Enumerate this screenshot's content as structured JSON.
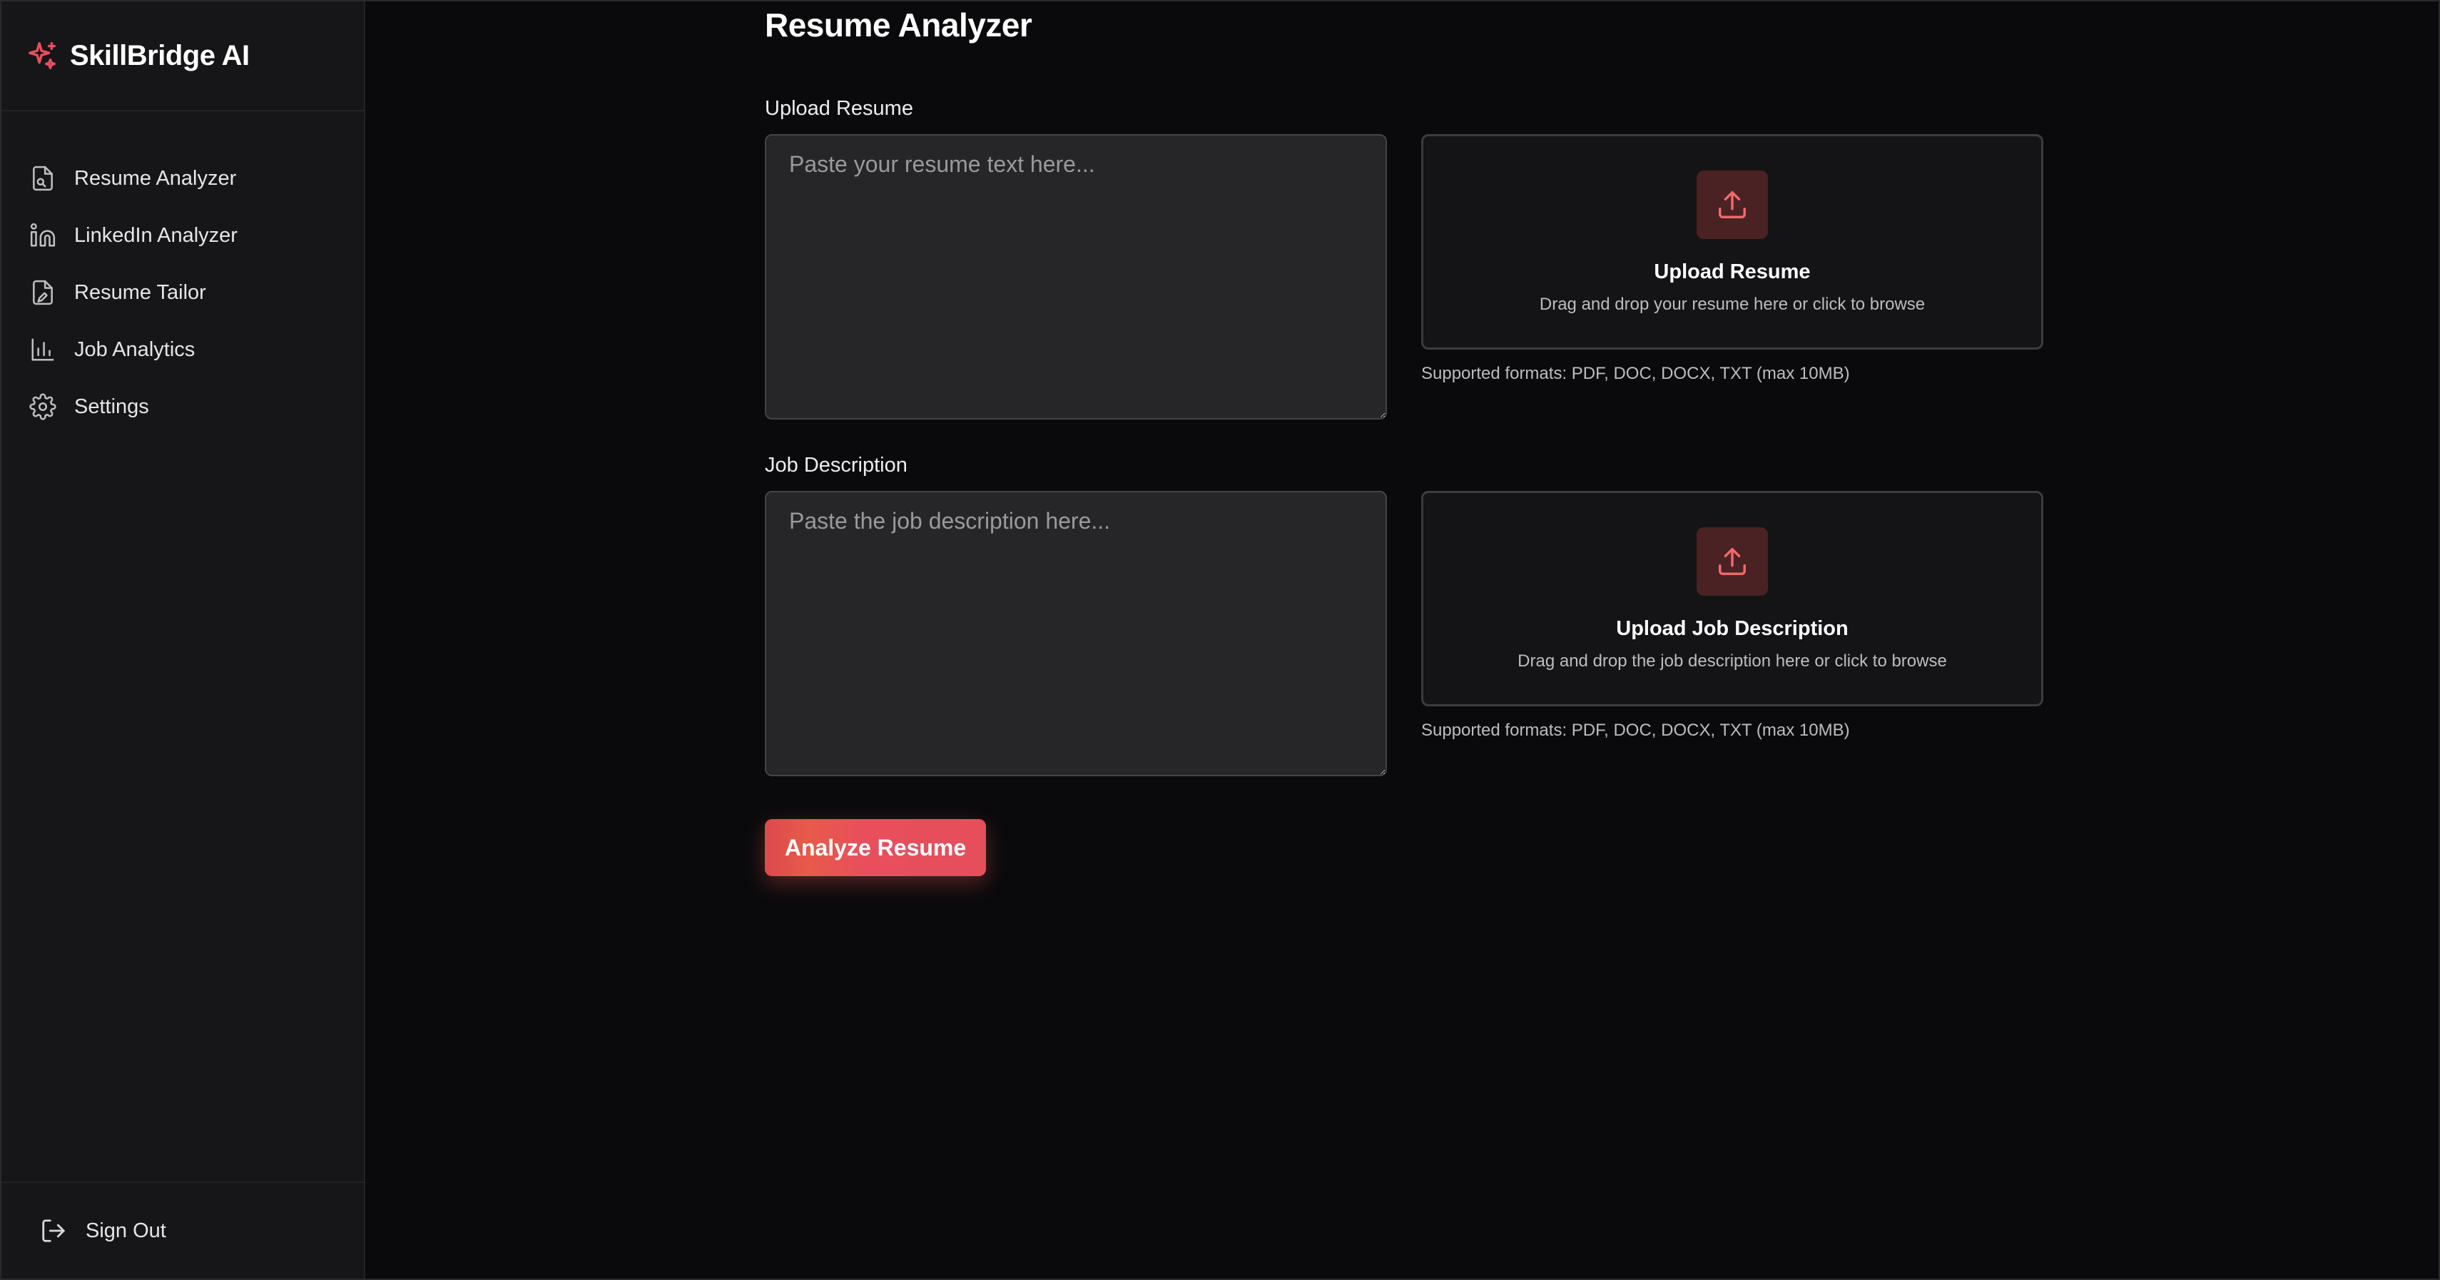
{
  "app": {
    "brand_name": "SkillBridge AI"
  },
  "colors": {
    "accent": "#e84e5c",
    "background": "#0a0a0c",
    "sidebar": "#161618"
  },
  "sidebar": {
    "items": [
      {
        "label": "Resume Analyzer",
        "icon": "file-search-icon"
      },
      {
        "label": "LinkedIn Analyzer",
        "icon": "linkedin-icon"
      },
      {
        "label": "Resume Tailor",
        "icon": "file-edit-icon"
      },
      {
        "label": "Job Analytics",
        "icon": "bar-chart-icon"
      },
      {
        "label": "Settings",
        "icon": "gear-icon"
      }
    ],
    "sign_out_label": "Sign Out"
  },
  "main": {
    "title": "Resume Analyzer",
    "resume": {
      "label": "Upload Resume",
      "placeholder": "Paste your resume text here...",
      "dropzone_title": "Upload Resume",
      "dropzone_subtitle": "Drag and drop your resume here or click to browse",
      "formats": "Supported formats: PDF, DOC, DOCX, TXT (max 10MB)"
    },
    "job": {
      "label": "Job Description",
      "placeholder": "Paste the job description here...",
      "dropzone_title": "Upload Job Description",
      "dropzone_subtitle": "Drag and drop the job description here or click to browse",
      "formats": "Supported formats: PDF, DOC, DOCX, TXT (max 10MB)"
    },
    "analyze_label": "Analyze Resume"
  }
}
